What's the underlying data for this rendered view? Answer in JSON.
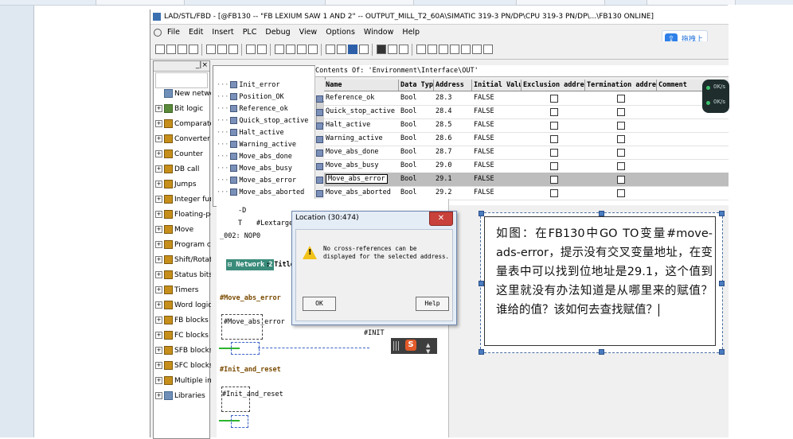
{
  "window": {
    "title": "LAD/STL/FBD  - [@FB130 -- \"FB LEXIUM SAW 1 AND 2\" -- OUTPUT_MILL_T2_60A\\SIMATIC 319-3 PN/DP\\CPU 319-3 PN/DP\\...\\FB130  ONLINE]"
  },
  "menu": [
    "File",
    "Edit",
    "Insert",
    "PLC",
    "Debug",
    "View",
    "Options",
    "Window",
    "Help"
  ],
  "upload_button": {
    "label": "拖拽上传",
    "icon": "cloud-upload-icon"
  },
  "catalog": {
    "items": [
      {
        "label": "New network",
        "icon": "new-network-icon"
      },
      {
        "label": "Bit logic",
        "icon": "folder-icon"
      },
      {
        "label": "Comparator",
        "icon": "folder-icon"
      },
      {
        "label": "Converter",
        "icon": "folder-icon"
      },
      {
        "label": "Counter",
        "icon": "folder-icon"
      },
      {
        "label": "DB call",
        "icon": "folder-icon"
      },
      {
        "label": "Jumps",
        "icon": "folder-icon"
      },
      {
        "label": "Integer function",
        "icon": "folder-icon"
      },
      {
        "label": "Floating-point",
        "icon": "folder-icon"
      },
      {
        "label": "Move",
        "icon": "folder-icon"
      },
      {
        "label": "Program control",
        "icon": "folder-icon"
      },
      {
        "label": "Shift/Rotate",
        "icon": "folder-icon"
      },
      {
        "label": "Status bits",
        "icon": "folder-icon"
      },
      {
        "label": "Timers",
        "icon": "folder-icon"
      },
      {
        "label": "Word logic",
        "icon": "folder-icon"
      },
      {
        "label": "FB blocks",
        "icon": "folder-icon"
      },
      {
        "label": "FC blocks",
        "icon": "folder-icon"
      },
      {
        "label": "SFB blocks",
        "icon": "folder-icon"
      },
      {
        "label": "SFC blocks",
        "icon": "folder-icon"
      },
      {
        "label": "Multiple instances",
        "icon": "folder-icon"
      },
      {
        "label": "Libraries",
        "icon": "folder-icon"
      }
    ]
  },
  "interface_tree": {
    "items": [
      "Init_error",
      "Position_OK",
      "Reference_ok",
      "Quick_stop_active",
      "Halt_active",
      "Warning_active",
      "Move_abs_done",
      "Move_abs_busy",
      "Move_abs_error",
      "Move_abs_aborted"
    ]
  },
  "contents": {
    "header": "Contents Of: 'Environment\\Interface\\OUT'"
  },
  "table": {
    "columns": [
      "Name",
      "Data Type",
      "Address",
      "Initial Value",
      "Exclusion address",
      "Termination address",
      "Comment"
    ],
    "rows": [
      {
        "name": "Reference_ok",
        "type": "Bool",
        "address": "28.3",
        "initial": "FALSE"
      },
      {
        "name": "Quick_stop_active",
        "type": "Bool",
        "address": "28.4",
        "initial": "FALSE"
      },
      {
        "name": "Halt_active",
        "type": "Bool",
        "address": "28.5",
        "initial": "FALSE"
      },
      {
        "name": "Warning_active",
        "type": "Bool",
        "address": "28.6",
        "initial": "FALSE"
      },
      {
        "name": "Move_abs_done",
        "type": "Bool",
        "address": "28.7",
        "initial": "FALSE"
      },
      {
        "name": "Move_abs_busy",
        "type": "Bool",
        "address": "29.0",
        "initial": "FALSE"
      },
      {
        "name": "Move_abs_error",
        "type": "Bool",
        "address": "29.1",
        "initial": "FALSE",
        "selected": true
      },
      {
        "name": "Move_abs_aborted",
        "type": "Bool",
        "address": "29.2",
        "initial": "FALSE"
      }
    ]
  },
  "speed_widget": {
    "lines": [
      "0K/s",
      "0K/s"
    ]
  },
  "ladder": {
    "top_lines": [
      "-D",
      "T",
      "#Lextargetm",
      "_002: NOP",
      "0"
    ],
    "network_label": "Network 2",
    "network_title": ": Title:",
    "coil_label_1": "#Move_abs_error",
    "coil_box_1": "#Move_abs_error",
    "init_label": "#INIT",
    "coil_label_2": "#Init_and_reset",
    "coil_box_2": "#Init_and_reset"
  },
  "dialog": {
    "title": "Location (30:474)",
    "message": "No cross-references can be displayed for the selected address.",
    "ok": "OK",
    "help": "Help"
  },
  "note": {
    "text": "如图：在FB130中GO TO变量#move-ads-error，提示没有交叉变量地址，在变量表中可以找到位地址是29.1，这个值到这里就没有办法知道是从哪里来的赋值？谁给的值？该如何去查找赋值？"
  },
  "colors": {
    "note_border": "#4a6fa5",
    "network_label_bg": "#3a8b7a",
    "selected_row": "#bdbdbd",
    "warning": "#f2c21b"
  }
}
